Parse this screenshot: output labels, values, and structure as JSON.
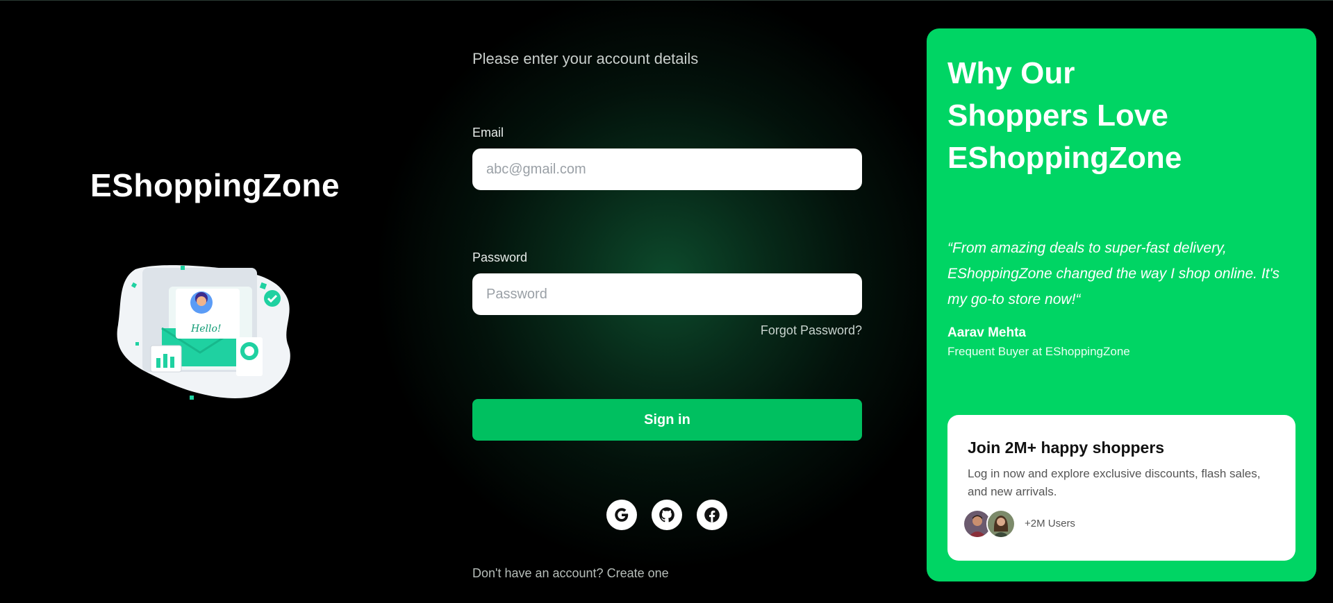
{
  "brand": {
    "name": "EShoppingZone"
  },
  "form": {
    "subtitle": "Please enter your account details",
    "email_label": "Email",
    "email_placeholder": "abc@gmail.com",
    "password_label": "Password",
    "password_placeholder": "Password",
    "forgot_label": "Forgot Password?",
    "signin_label": "Sign in",
    "signup_prefix": "Don't have an account?",
    "signup_link": "Create one"
  },
  "social": [
    {
      "icon": "google-icon"
    },
    {
      "icon": "github-icon"
    },
    {
      "icon": "facebook-icon"
    }
  ],
  "illustration": {
    "card_text": "Hello!"
  },
  "panel": {
    "title_line1": "Why Our",
    "title_line2": "Shoppers Love",
    "title_line3": "EShoppingZone",
    "quote": "“From amazing deals to super-fast delivery, EShoppingZone changed the way I shop online. It's my go-to store now!“",
    "author": "Aarav Mehta",
    "role": "Frequent Buyer at EShoppingZone",
    "card": {
      "title": "Join 2M+ happy shoppers",
      "text": "Log in now and explore exclusive discounts, flash sales, and new arrivals.",
      "users_label": "+2M Users"
    }
  },
  "colors": {
    "accent": "#00c060",
    "panel": "#00d564",
    "illustration_teal": "#1fd1a1"
  }
}
